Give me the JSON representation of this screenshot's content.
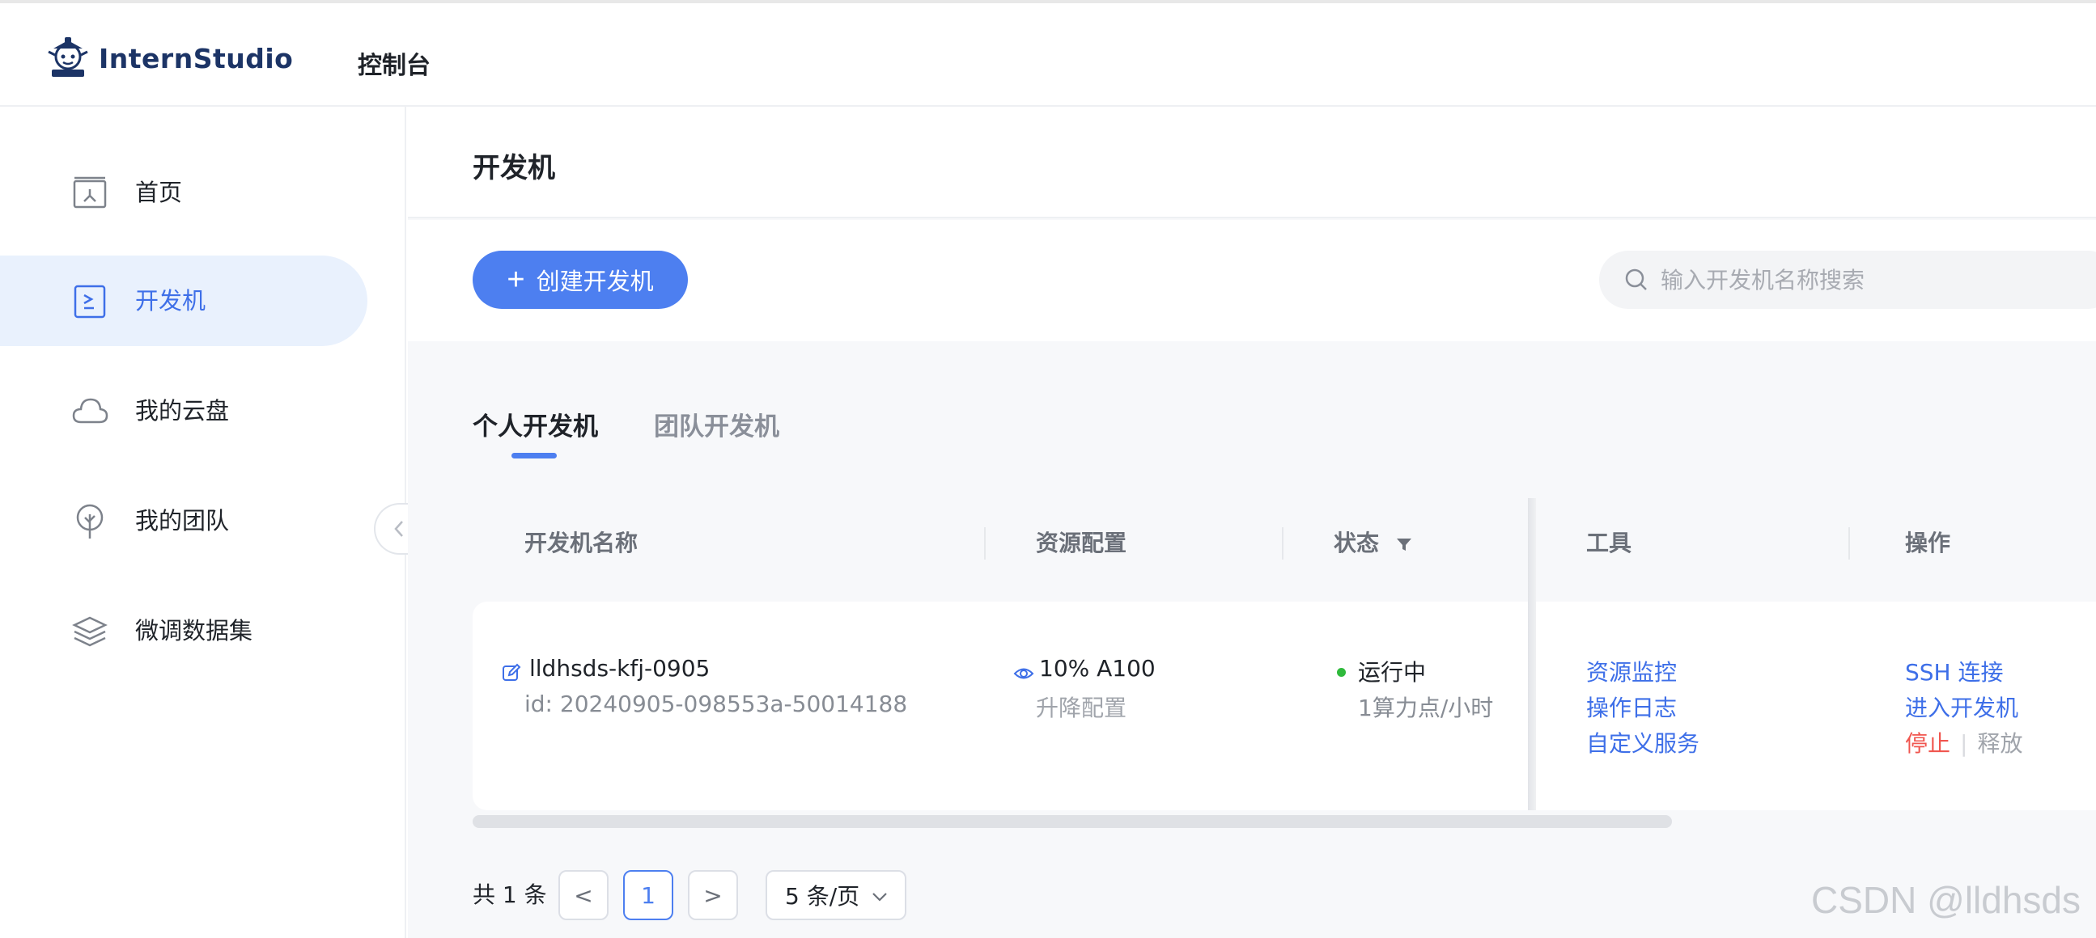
{
  "header": {
    "logo_text": "InternStudio",
    "console_label": "控制台"
  },
  "sidebar": {
    "items": [
      {
        "label": "首页",
        "icon": "home-icon",
        "active": false
      },
      {
        "label": "开发机",
        "icon": "terminal-icon",
        "active": true
      },
      {
        "label": "我的云盘",
        "icon": "cloud-icon",
        "active": false
      },
      {
        "label": "我的团队",
        "icon": "tree-icon",
        "active": false
      },
      {
        "label": "微调数据集",
        "icon": "layers-icon",
        "active": false
      }
    ]
  },
  "main": {
    "title": "开发机",
    "create_button": "创建开发机",
    "search_placeholder": "输入开发机名称搜索",
    "tabs": [
      {
        "label": "个人开发机",
        "active": true
      },
      {
        "label": "团队开发机",
        "active": false
      }
    ],
    "table": {
      "columns": [
        "开发机名称",
        "资源配置",
        "状态",
        "工具",
        "操作"
      ],
      "rows": [
        {
          "name": "lldhsds-kfj-0905",
          "id": "id: 20240905-098553a-50014188",
          "resource": "10% A100",
          "resource_action": "升降配置",
          "status": "运行中",
          "cost": "1算力点/小时",
          "tools": [
            "资源监控",
            "操作日志",
            "自定义服务"
          ],
          "ops": {
            "ssh": "SSH 连接",
            "enter": "进入开发机",
            "stop": "停止",
            "release": "释放"
          }
        }
      ]
    },
    "pagination": {
      "total": "共 1 条",
      "prev": "<",
      "current_page": "1",
      "next": ">",
      "page_size": "5 条/页"
    }
  },
  "watermark": "CSDN @lldhsds",
  "colors": {
    "accent": "#4d7ff0",
    "active_bg": "#e9f1fd",
    "status_running": "#2fba3c",
    "danger": "#f0564f"
  }
}
